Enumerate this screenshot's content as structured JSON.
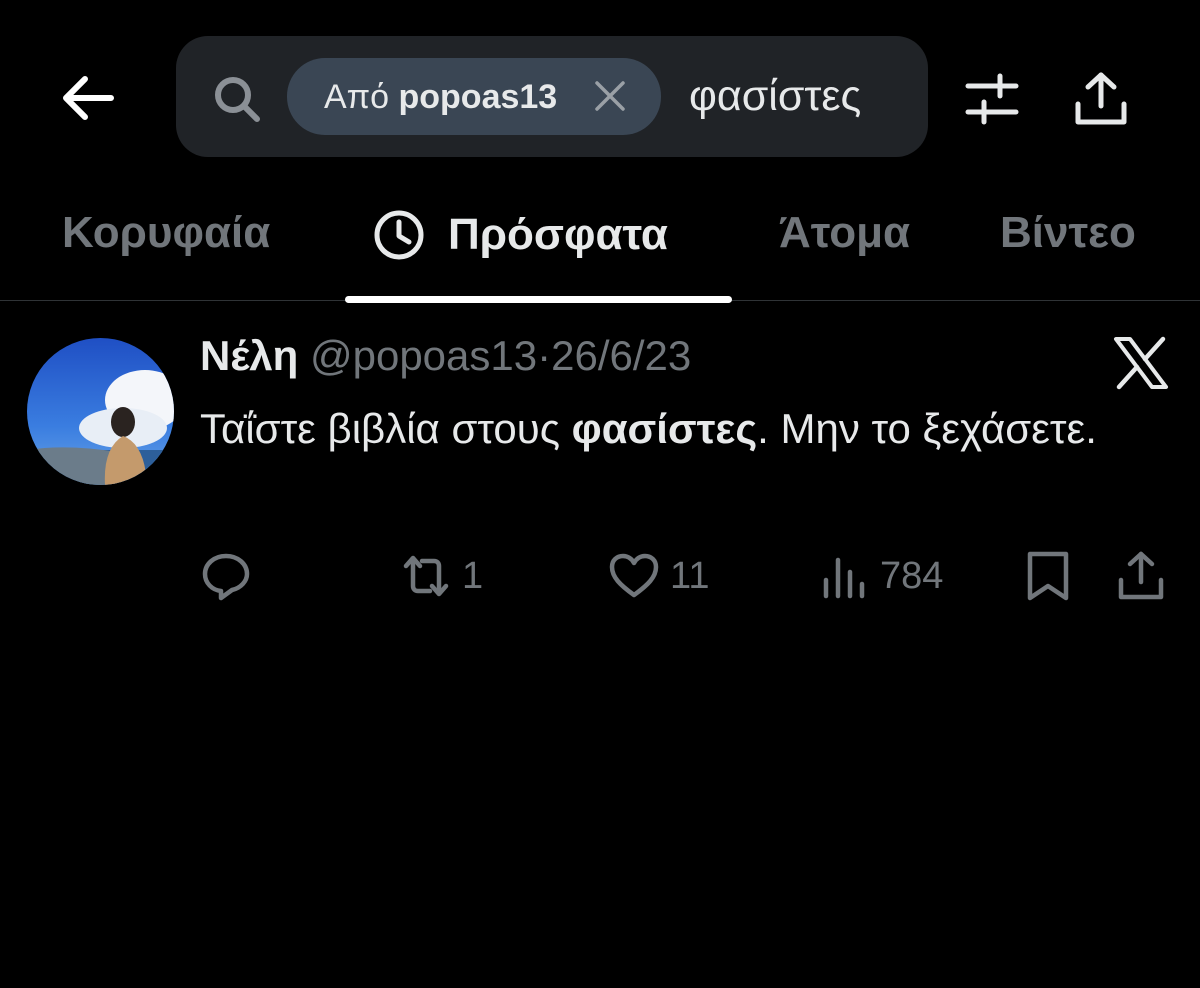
{
  "search": {
    "chip_prefix": "Από",
    "chip_user": "popoas13",
    "query": "φασίστες"
  },
  "tabs": [
    {
      "label": "Κορυφαία"
    },
    {
      "label": "Πρόσφατα"
    },
    {
      "label": "Άτομα"
    },
    {
      "label": "Βίντεο"
    }
  ],
  "tweet": {
    "name": "Νέλη",
    "handle": "@popoas13",
    "separator": "·",
    "date": "26/6/23",
    "text_before": "Ταΐστε βιβλία στους ",
    "text_bold": "φασίστες",
    "text_after": ". Μην το ξεχάσετε.",
    "retweets": "1",
    "likes": "11",
    "views": "784"
  },
  "colors": {
    "background": "#000000",
    "text_primary": "#e7e9ea",
    "text_secondary": "#71767b",
    "search_bg": "#202327",
    "chip_bg": "#3a4654"
  },
  "icons": [
    "back-arrow-icon",
    "search-icon",
    "close-icon",
    "filter-icon",
    "share-icon",
    "clock-icon",
    "x-logo-icon",
    "reply-icon",
    "retweet-icon",
    "like-icon",
    "views-icon",
    "bookmark-icon"
  ]
}
